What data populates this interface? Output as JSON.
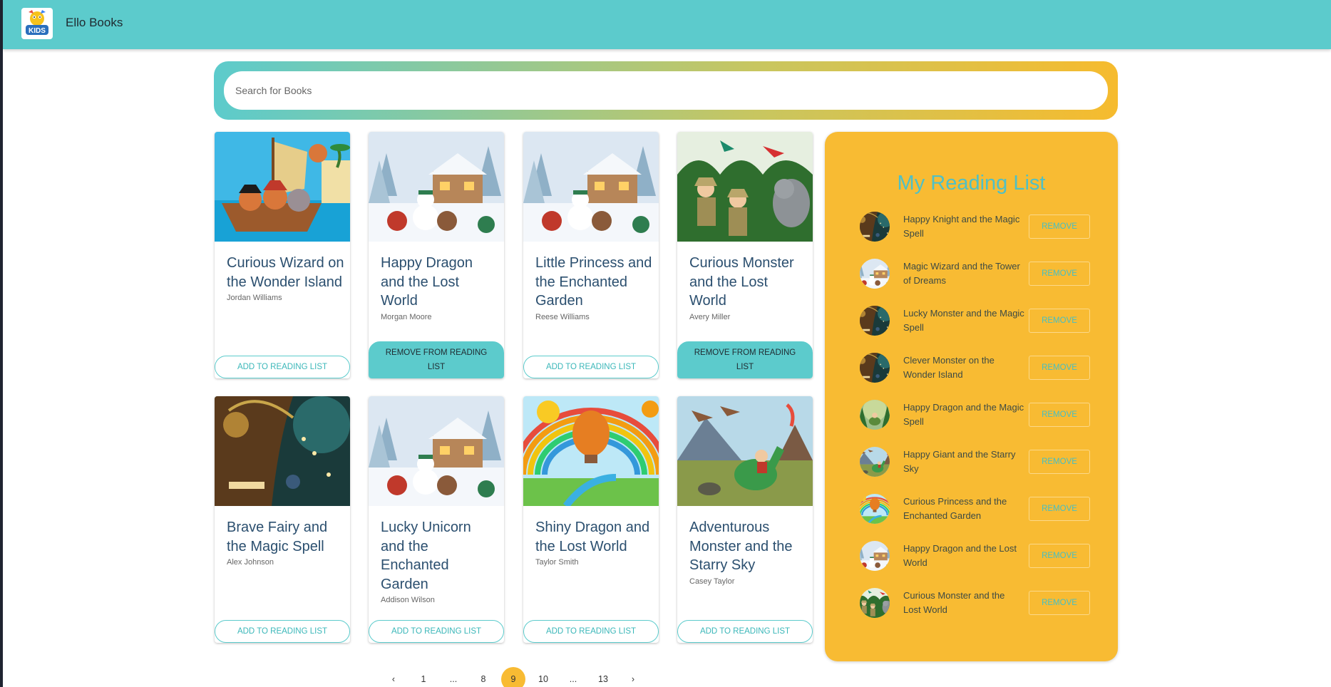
{
  "app": {
    "name": "Ello Books",
    "logo_text": "KIDS"
  },
  "search": {
    "placeholder": "Search for Books",
    "value": ""
  },
  "books": [
    {
      "title": "Curious Wizard on the Wonder Island",
      "author": "Jordan Williams",
      "action": "ADD TO READING LIST",
      "cover": "pirate-ship-icon"
    },
    {
      "title": "Happy Dragon and the Lost World",
      "author": "Morgan Moore",
      "action": "REMOVE FROM READING LIST",
      "cover": "snowy-cottage-icon"
    },
    {
      "title": "Little Princess and the Enchanted Garden",
      "author": "Reese Williams",
      "action": "ADD TO READING LIST",
      "cover": "snowy-cottage-icon"
    },
    {
      "title": "Curious Monster and the Lost World",
      "author": "Avery Miller",
      "action": "REMOVE FROM READING LIST",
      "cover": "jungle-explorers-icon"
    },
    {
      "title": "Brave Fairy and the Magic Spell",
      "author": "Alex Johnson",
      "action": "ADD TO READING LIST",
      "cover": "magic-tree-icon"
    },
    {
      "title": "Lucky Unicorn and the Enchanted Garden",
      "author": "Addison Wilson",
      "action": "ADD TO READING LIST",
      "cover": "snowy-cottage-icon"
    },
    {
      "title": "Shiny Dragon and the Lost World",
      "author": "Taylor Smith",
      "action": "ADD TO READING LIST",
      "cover": "hot-air-balloon-icon"
    },
    {
      "title": "Adventurous Monster and the Starry Sky",
      "author": "Casey Taylor",
      "action": "ADD TO READING LIST",
      "cover": "dinosaur-volcano-icon"
    }
  ],
  "reading_list": {
    "heading": "My Reading List",
    "remove_label": "REMOVE",
    "items": [
      {
        "title": "Happy Knight and the Magic Spell",
        "thumb": "magic-tree-icon"
      },
      {
        "title": "Magic Wizard and the Tower of Dreams",
        "thumb": "snowy-cottage-icon"
      },
      {
        "title": "Lucky Monster and the Magic Spell",
        "thumb": "magic-tree-icon"
      },
      {
        "title": "Clever Monster on the Wonder Island",
        "thumb": "magic-tree-icon"
      },
      {
        "title": "Happy Dragon and the Magic Spell",
        "thumb": "forest-icon"
      },
      {
        "title": "Happy Giant and the Starry Sky",
        "thumb": "dinosaur-volcano-icon"
      },
      {
        "title": "Curious Princess and the Enchanted Garden",
        "thumb": "hot-air-balloon-icon"
      },
      {
        "title": "Happy Dragon and the Lost World",
        "thumb": "snowy-cottage-icon"
      },
      {
        "title": "Curious Monster and the Lost World",
        "thumb": "jungle-explorers-icon"
      }
    ]
  },
  "pagination": {
    "prev": "‹",
    "next": "›",
    "pages": [
      "1",
      "...",
      "8",
      "9",
      "10",
      "...",
      "13"
    ],
    "current": "9"
  },
  "colors": {
    "primary": "#5ccbcc",
    "accent": "#f8bb33",
    "title_text": "#2b4f6f"
  }
}
